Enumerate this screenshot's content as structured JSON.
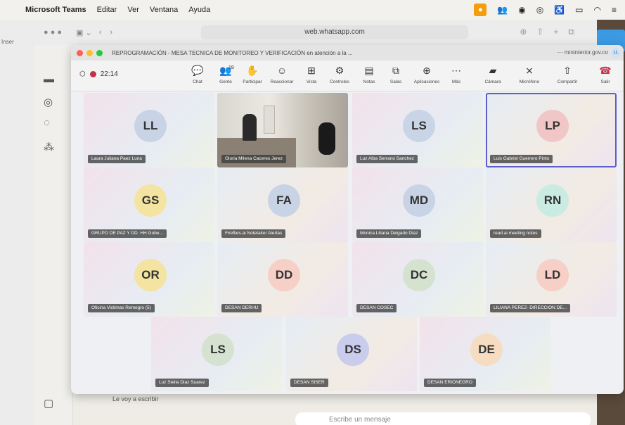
{
  "menubar": {
    "items": [
      "Microsoft Teams",
      "Editar",
      "Ver",
      "Ventana",
      "Ayuda"
    ]
  },
  "background": {
    "word_tab": "Inser",
    "safari_url": "web.whatsapp.com",
    "whatsapp_last_message": "Le voy a escribir",
    "whatsapp_input_placeholder": "Escribe un mensaje"
  },
  "teams": {
    "window_title": "REPROGRAMACIÓN - MESA TECNICA DE MONITOREO Y VERIFICACIÓN en atención a la ...",
    "domain": "mininterior.gov.co",
    "timer": "22:14",
    "people_count": "18",
    "toolbar": [
      {
        "id": "chat",
        "label": "Chat",
        "icon": "chat-icon",
        "glyph": "💬"
      },
      {
        "id": "people",
        "label": "Gente",
        "icon": "people-icon",
        "glyph": "👥"
      },
      {
        "id": "raise",
        "label": "Participar",
        "icon": "hand-icon",
        "glyph": "✋"
      },
      {
        "id": "react",
        "label": "Reaccionar",
        "icon": "smiley-icon",
        "glyph": "☺"
      },
      {
        "id": "view",
        "label": "Vista",
        "icon": "grid-icon",
        "glyph": "⊞"
      },
      {
        "id": "controls",
        "label": "Controles",
        "icon": "controls-icon",
        "glyph": "⚙"
      },
      {
        "id": "notes",
        "label": "Notas",
        "icon": "notes-icon",
        "glyph": "▤"
      },
      {
        "id": "rooms",
        "label": "Salas",
        "icon": "rooms-icon",
        "glyph": "⧉"
      },
      {
        "id": "apps",
        "label": "Aplicaciones",
        "icon": "apps-icon",
        "glyph": "⊕"
      },
      {
        "id": "more",
        "label": "Más",
        "icon": "more-icon",
        "glyph": "⋯"
      },
      {
        "id": "camera",
        "label": "Cámara",
        "icon": "camera-off-icon",
        "glyph": "▰"
      },
      {
        "id": "mic",
        "label": "Micrófono",
        "icon": "mic-off-icon",
        "glyph": "⨯"
      },
      {
        "id": "share",
        "label": "Compartir",
        "icon": "share-icon",
        "glyph": "⇧"
      }
    ],
    "leave_label": "Salir",
    "participants": [
      {
        "initials": "LL",
        "name": "Laura Juliana Paez Luna",
        "color": "#c8d3e6"
      },
      {
        "initials": "",
        "name": "Gloria Milena Caceres Jerez",
        "color": "",
        "video": true
      },
      {
        "initials": "LS",
        "name": "Luz Alba Serrano Sanchez",
        "color": "#c9d5e7"
      },
      {
        "initials": "LP",
        "name": "Luis Gabriel Guerrero Pinto",
        "color": "#f1c6c6"
      },
      {
        "initials": "GS",
        "name": "GRUPO DE PAZ Y DD. HH Gobe...",
        "color": "#f4e4a1"
      },
      {
        "initials": "FA",
        "name": "Fireflies.ai Notetaker Alertas",
        "color": "#c8d3e6"
      },
      {
        "initials": "MD",
        "name": "Monica Liliana Delgado Diaz",
        "color": "#c8d3e6"
      },
      {
        "initials": "RN",
        "name": "read.ai meeting notes",
        "color": "#c9ebe2"
      },
      {
        "initials": "OR",
        "name": "Oficina Victimas Remegro (5)",
        "color": "#f4e4a1"
      },
      {
        "initials": "DD",
        "name": "DESAN DERHU",
        "color": "#f6cfc7"
      },
      {
        "initials": "DC",
        "name": "DESAN COSEC",
        "color": "#d5e2cf"
      },
      {
        "initials": "LD",
        "name": "LILIANA PEREZ- DIRECCION DE...",
        "color": "#f6cfc7"
      },
      {
        "initials": "LS",
        "name": "Luz Stella Diaz Suarez",
        "color": "#d5e2cf"
      },
      {
        "initials": "DS",
        "name": "DESAN SISER",
        "color": "#c9ccec"
      },
      {
        "initials": "DE",
        "name": "DESAN ERIONEGRO",
        "color": "#f6dcc0"
      }
    ]
  }
}
